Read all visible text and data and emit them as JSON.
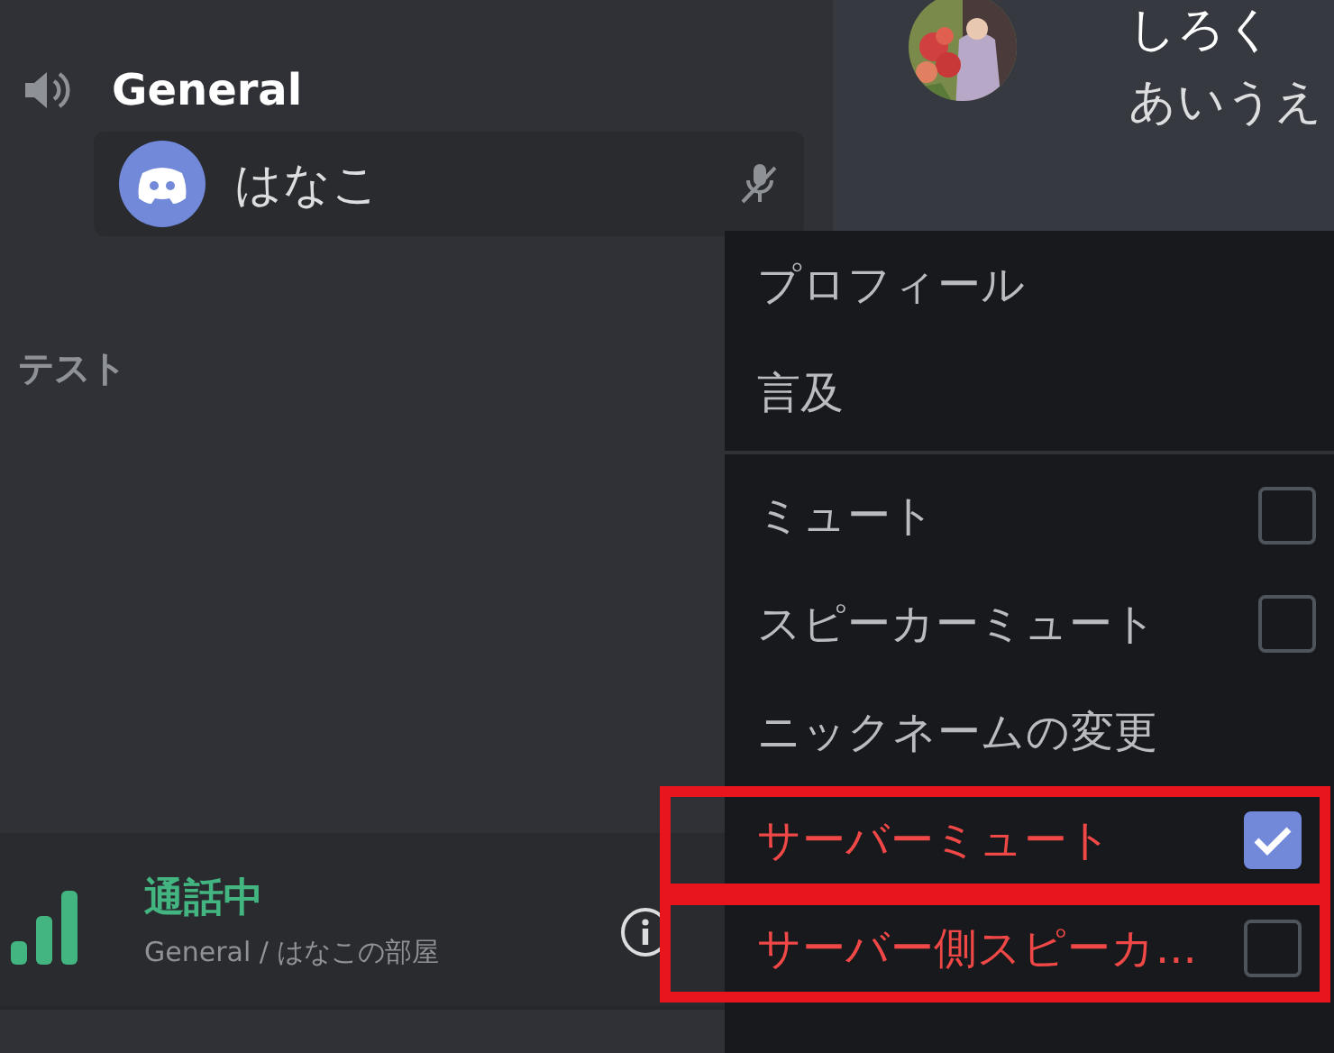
{
  "sidebar": {
    "voice_channel": {
      "name": "General",
      "members": [
        {
          "name": "はなこ",
          "muted": true
        }
      ]
    },
    "category": "テスト"
  },
  "chat": {
    "message": {
      "author": "しろく",
      "text": "あいうえ"
    }
  },
  "voice_status": {
    "status": "通話中",
    "location": "General / はなこの部屋"
  },
  "context_menu": {
    "items": [
      {
        "kind": "action",
        "label": "プロフィール"
      },
      {
        "kind": "action",
        "label": "言及"
      },
      {
        "kind": "divider"
      },
      {
        "kind": "checkbox",
        "label": "ミュート",
        "checked": false,
        "danger": false,
        "highlighted": false
      },
      {
        "kind": "checkbox",
        "label": "スピーカーミュート",
        "checked": false,
        "danger": false,
        "highlighted": false
      },
      {
        "kind": "action",
        "label": "ニックネームの変更"
      },
      {
        "kind": "checkbox",
        "label": "サーバーミュート",
        "checked": true,
        "danger": true,
        "highlighted": true
      },
      {
        "kind": "checkbox",
        "label": "サーバー側スピーカ...",
        "checked": false,
        "danger": true,
        "highlighted": true
      }
    ]
  }
}
